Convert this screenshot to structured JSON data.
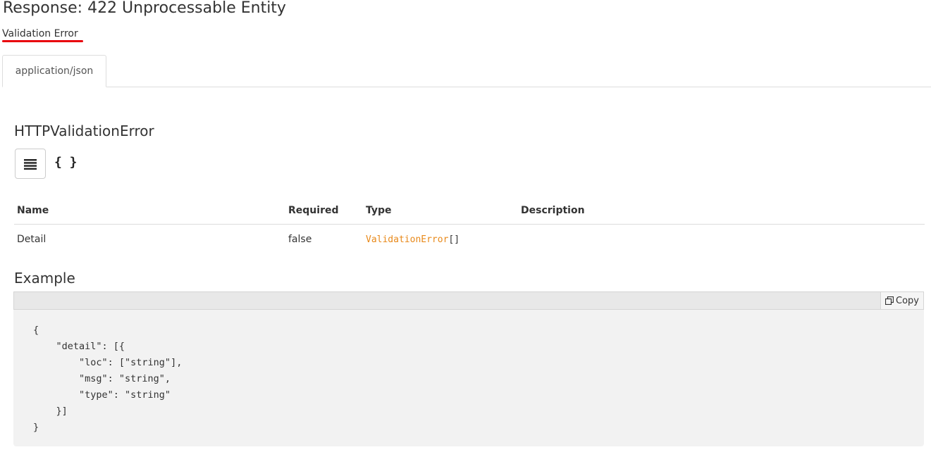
{
  "response": {
    "title": "Response: 422 Unprocessable Entity",
    "description": "Validation Error"
  },
  "tabs": [
    {
      "label": "application/json",
      "active": true
    }
  ],
  "schema": {
    "title": "HTTPValidationError",
    "view_toggle_icon": "list-icon",
    "json_toggle_label": "{ }"
  },
  "table": {
    "headers": [
      "Name",
      "Required",
      "Type",
      "Description"
    ],
    "rows": [
      {
        "name": "Detail",
        "required": "false",
        "type": "ValidationError",
        "type_suffix": "[]",
        "description": ""
      }
    ]
  },
  "example": {
    "title": "Example",
    "copy_label": "Copy",
    "copy_icon": "copy-icon",
    "code": "{\n    \"detail\": [{\n        \"loc\": [\"string\"],\n        \"msg\": \"string\",\n        \"type\": \"string\"\n    }]\n}"
  },
  "colors": {
    "accent_underline": "#e8000b",
    "type_link": "#e8891a"
  }
}
